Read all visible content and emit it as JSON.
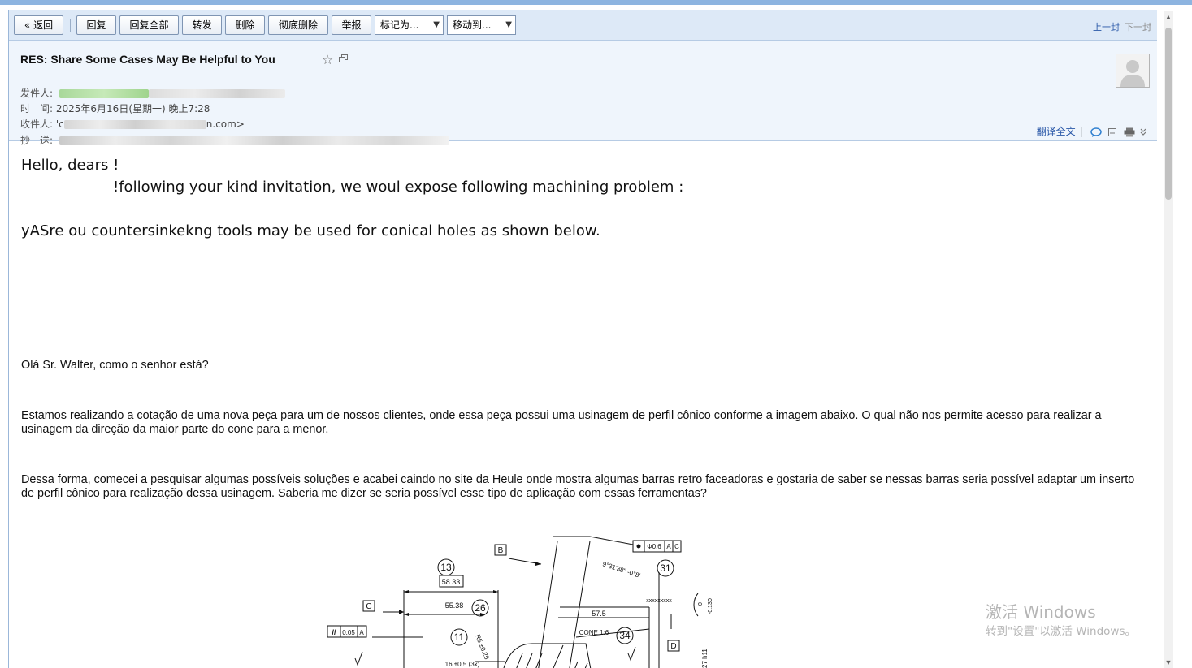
{
  "toolbar": {
    "back": "« 返回",
    "reply": "回复",
    "reply_all": "回复全部",
    "forward": "转发",
    "delete": "删除",
    "delete_forever": "彻底删除",
    "report": "举报",
    "mark_as": "标记为...",
    "move_to": "移动到...",
    "prev": "上一封",
    "next": "下一封"
  },
  "header": {
    "subject": "RES: Share  Some Cases May Be Helpful to You",
    "from_label": "发件人:",
    "time_label": "时　间:",
    "time_value": "2025年6月16日(星期一) 晚上7:28",
    "to_label": "收件人:",
    "to_prefix": "'c",
    "to_suffix": "n.com>",
    "cc_label": "抄　送:",
    "translate": "翻译全文",
    "separator": "|"
  },
  "body": {
    "greeting": "Hello, dears !",
    "line2": "!following your kind invitation, we woul expose following  machining problem :",
    "line3": "yASre ou countersinkekng tools  may be used for conical holes as shown below.",
    "p1": "Olá Sr. Walter, como o senhor está?",
    "p2": "Estamos realizando a cotação de uma nova peça para um de nossos clientes, onde essa peça possui uma usinagem de perfil cônico conforme a imagem abaixo. O qual não nos permite acesso para realizar a usinagem da direção da maior parte do cone para a menor.",
    "p3": "Dessa forma, comecei a pesquisar algumas possíveis soluções e acabei caindo no site da Heule onde mostra algumas barras retro faceadoras e gostaria de saber se nessas barras seria possível adaptar um inserto de perfil cônico para realização dessa usinagem. Saberia me dizer se seria possível esse tipo de aplicação com essas ferramentas?"
  },
  "drawing": {
    "balloons": [
      "13",
      "26",
      "11",
      "31",
      "34"
    ],
    "datums": [
      "B",
      "C",
      "D"
    ],
    "dims": [
      "58.33",
      "55.38",
      "57.5",
      "16 ±0.5 (3x)",
      "CONE 1:6",
      "R5 ±0.25",
      "9°31'38\" -0°8'",
      "xxxxxxxxx",
      "27 h11",
      "0",
      "-0.130",
      "Φ0.6",
      "A",
      "C",
      "//",
      "0.05",
      "A"
    ]
  },
  "watermark": {
    "line1": "激活 Windows",
    "line2": "转到\"设置\"以激活 Windows。"
  }
}
